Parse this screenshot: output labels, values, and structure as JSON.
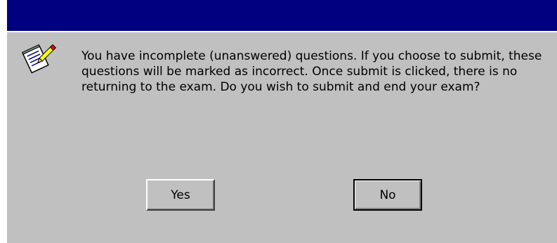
{
  "dialog": {
    "message": "You have incomplete (unanswered) questions. If you choose to submit, these questions will be marked as incorrect. Once submit is clicked, there is no returning to the exam. Do you wish to submit and end your exam?",
    "icon": "notepad-pencil-icon",
    "buttons": {
      "yes_label": "Yes",
      "no_label": "No"
    }
  },
  "colors": {
    "titlebar": "#000080",
    "face": "#c0c0c0"
  }
}
